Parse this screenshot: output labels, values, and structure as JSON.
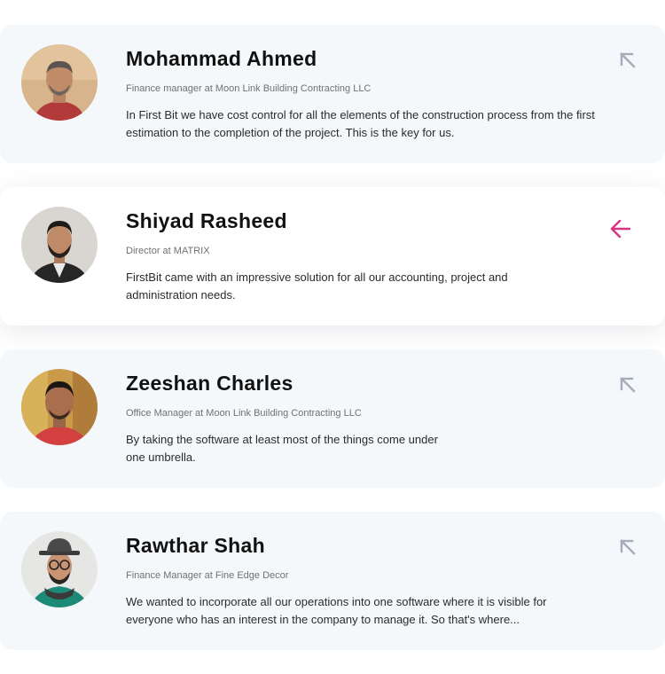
{
  "accent_color": "#d63384",
  "icon_color": "#a5adb8",
  "testimonials": [
    {
      "name": "Mohammad Ahmed",
      "role": "Finance manager at Moon Link Building Contracting LLC",
      "quote": "In First Bit we have cost control for all the elements of the construction process from the first estimation to the completion of the project. This is the key for us.",
      "icon": "arrow-up-left-icon",
      "active": false
    },
    {
      "name": "Shiyad Rasheed",
      "role": "Director at MATRIX",
      "quote": "FirstBit came with an impressive solution for all our accounting, project and administration needs.",
      "icon": "arrow-left-icon",
      "active": true
    },
    {
      "name": "Zeeshan Charles",
      "role": "Office Manager at Moon Link Building Contracting LLC",
      "quote": "By taking the software at least most of the things come under one umbrella.",
      "icon": "arrow-up-left-icon",
      "active": false
    },
    {
      "name": "Rawthar Shah",
      "role": "Finance Manager at Fine Edge Decor",
      "quote": "We wanted to incorporate all our operations into one software where it is visible for everyone who has an interest in the company to manage it. So that's where...",
      "icon": "arrow-up-left-icon",
      "active": false
    }
  ]
}
